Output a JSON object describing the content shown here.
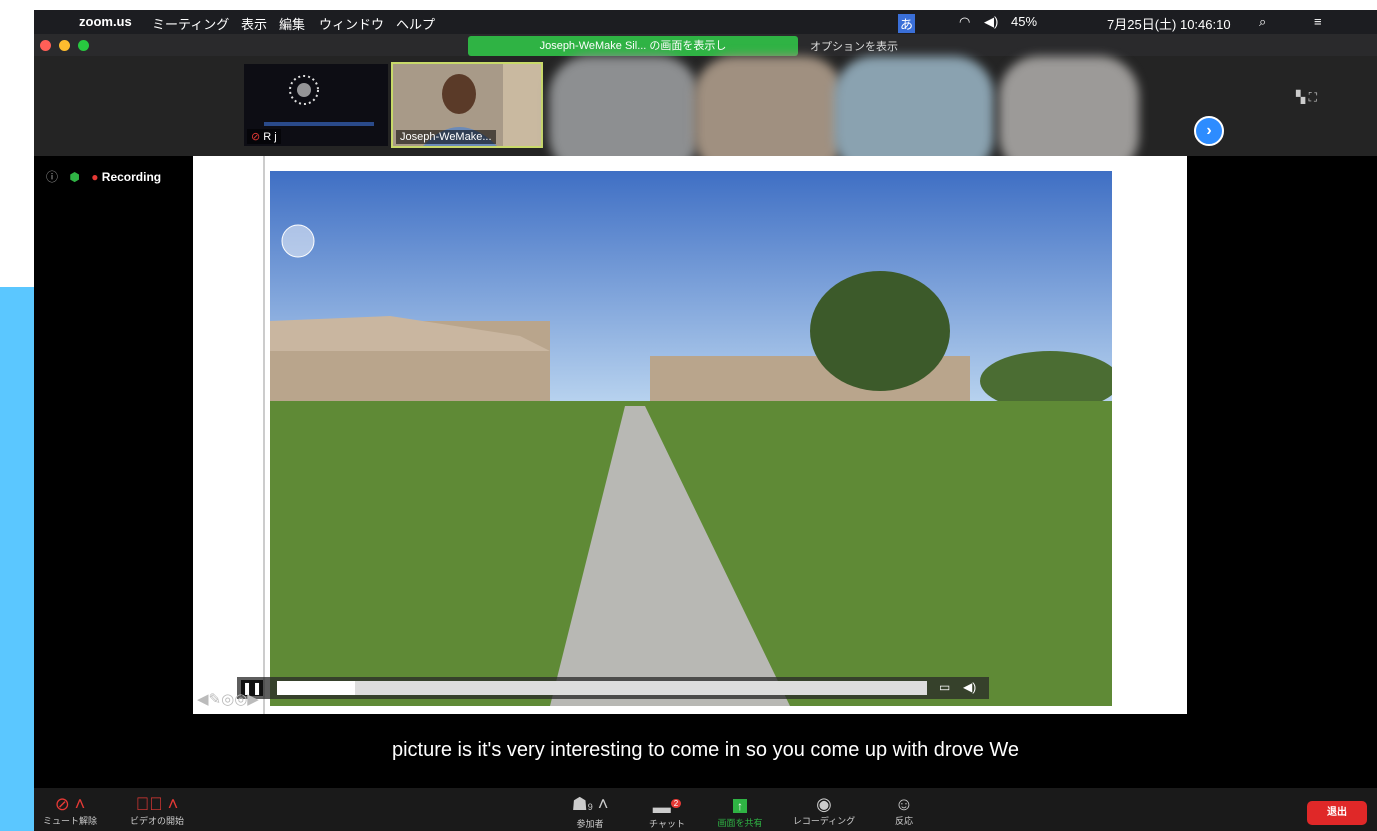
{
  "menubar": {
    "app": "zoom.us",
    "items": [
      "ミーティング",
      "表示",
      "編集",
      "ウィンドウ",
      "ヘルプ"
    ],
    "battery": "45%",
    "datetime": "7月25日(土) 10:46:10",
    "input_method": "あ"
  },
  "window": {
    "share_banner": "Joseph-WeMake Sil... の画面を表示し",
    "options": "オプションを表示"
  },
  "participants": [
    {
      "name": "R j"
    },
    {
      "name": "Joseph-WeMake..."
    }
  ],
  "recording": {
    "label": "Recording"
  },
  "caption": {
    "line1": "picture is it's very interesting to come in so you come up with drove We"
  },
  "toolbar": {
    "mute": "ミュート解除",
    "video": "ビデオの開始",
    "participants": "参加者",
    "participants_count": "9",
    "chat": "チャット",
    "chat_badge": "2",
    "share": "画面を共有",
    "record": "レコーディング",
    "reactions": "反応",
    "end": "退出"
  },
  "colors": {
    "share_green": "#2fb344",
    "accent_blue": "#2d8cff",
    "end_red": "#e02828",
    "recording_red": "#e53935"
  }
}
